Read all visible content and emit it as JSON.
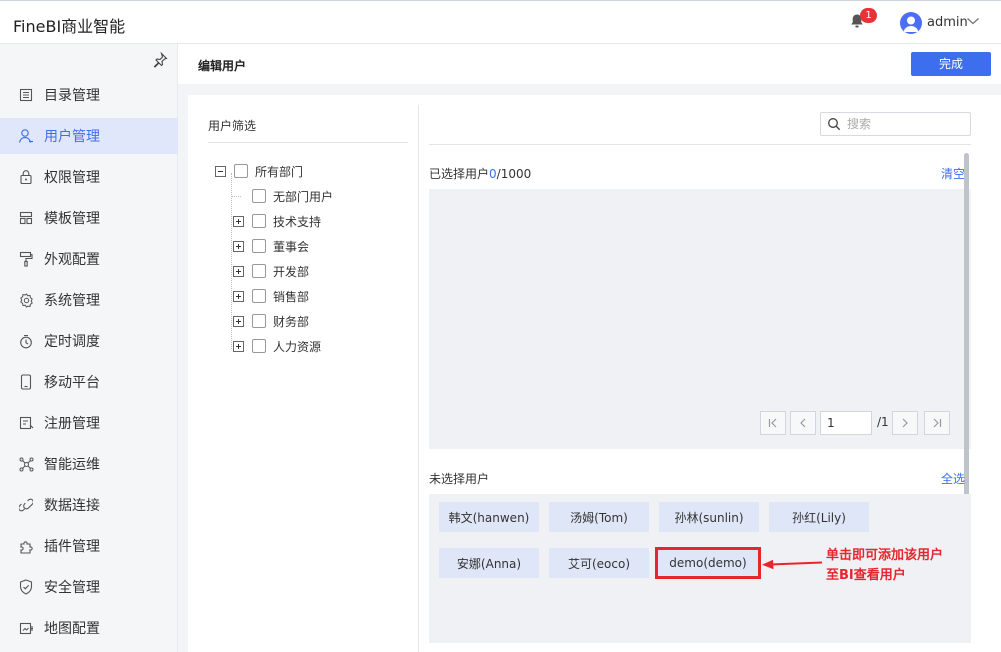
{
  "app": {
    "title": "FineBI商业智能"
  },
  "header": {
    "notification_count": "1",
    "user_name": "admin"
  },
  "sidebar": {
    "items": [
      {
        "label": "目录管理",
        "icon": "catalog-icon"
      },
      {
        "label": "用户管理",
        "icon": "user-icon",
        "active": true
      },
      {
        "label": "权限管理",
        "icon": "lock-icon"
      },
      {
        "label": "模板管理",
        "icon": "template-icon"
      },
      {
        "label": "外观配置",
        "icon": "paint-roller-icon"
      },
      {
        "label": "系统管理",
        "icon": "gear-icon"
      },
      {
        "label": "定时调度",
        "icon": "timer-icon"
      },
      {
        "label": "移动平台",
        "icon": "mobile-icon"
      },
      {
        "label": "注册管理",
        "icon": "register-icon"
      },
      {
        "label": "智能运维",
        "icon": "network-icon"
      },
      {
        "label": "数据连接",
        "icon": "link-icon"
      },
      {
        "label": "插件管理",
        "icon": "puzzle-icon"
      },
      {
        "label": "安全管理",
        "icon": "shield-icon"
      },
      {
        "label": "地图配置",
        "icon": "map-icon"
      }
    ]
  },
  "page": {
    "title": "编辑用户",
    "done_label": "完成"
  },
  "filter": {
    "title": "用户筛选",
    "tree": [
      {
        "label": "所有部门",
        "expander": "minus"
      },
      {
        "label": "无部门用户",
        "expander": "none"
      },
      {
        "label": "技术支持",
        "expander": "plus"
      },
      {
        "label": "董事会",
        "expander": "plus"
      },
      {
        "label": "开发部",
        "expander": "plus"
      },
      {
        "label": "销售部",
        "expander": "plus"
      },
      {
        "label": "财务部",
        "expander": "plus"
      },
      {
        "label": "人力资源",
        "expander": "plus"
      }
    ]
  },
  "search": {
    "placeholder": "搜索",
    "value": ""
  },
  "selected": {
    "label_prefix": "已选择用户",
    "count": "0",
    "total": "/1000",
    "clear_label": "清空"
  },
  "pager": {
    "current": "1",
    "total": "/1"
  },
  "unselected": {
    "label": "未选择用户",
    "select_all_label": "全选",
    "users": [
      "韩文(hanwen)",
      "汤姆(Tom)",
      "孙林(sunlin)",
      "孙红(Lily)",
      "安娜(Anna)",
      "艾可(eoco)",
      "demo(demo)"
    ]
  },
  "annotation": {
    "line1": "单击即可添加该用户",
    "line2": "至BI查看用户",
    "color": "#e5272d"
  },
  "colors": {
    "accent": "#3d6eee",
    "badge": "#e8323a"
  }
}
